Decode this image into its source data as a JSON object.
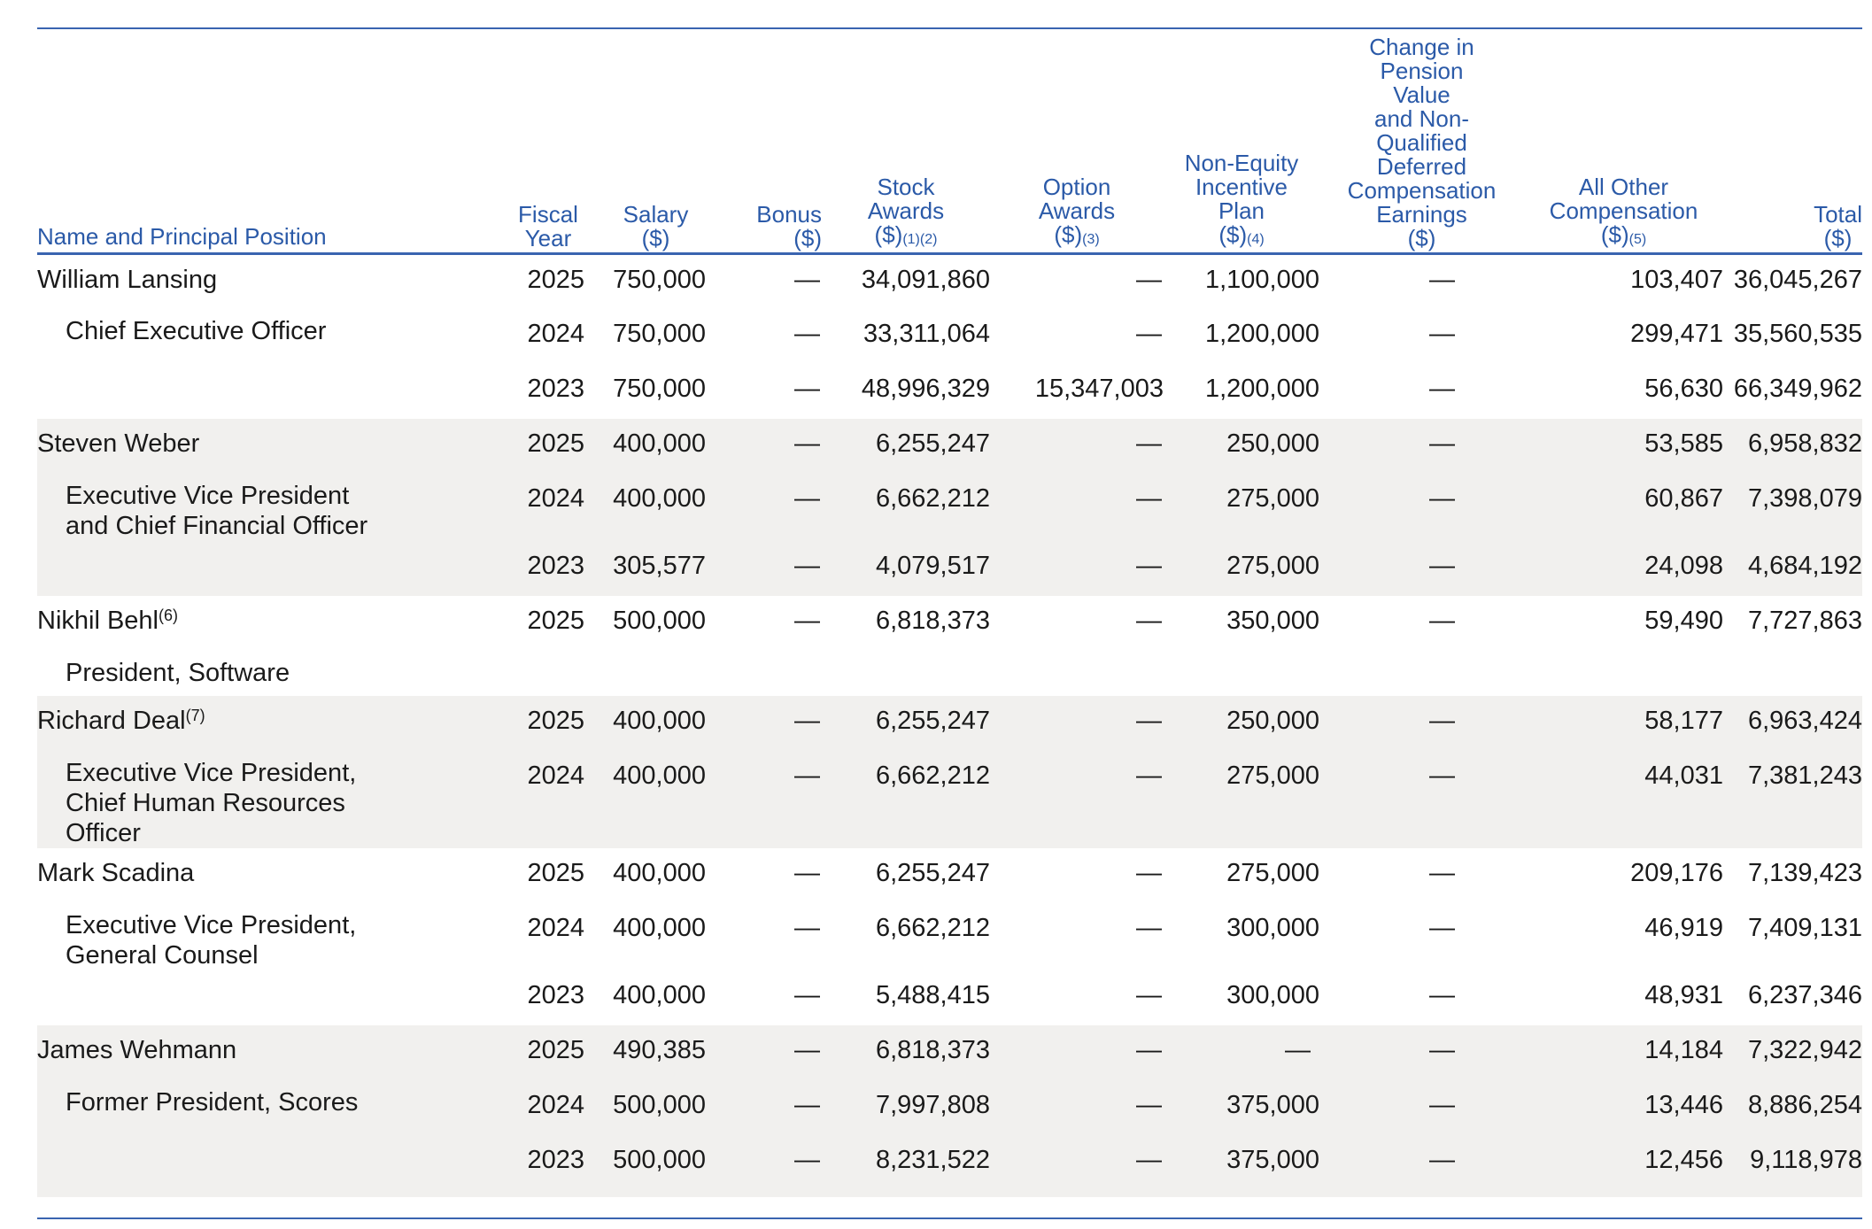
{
  "headers": {
    "name": "Name and Principal Position",
    "fiscal_year": "Fiscal\nYear",
    "salary": "Salary\n($)",
    "bonus": "Bonus\n($)",
    "stock_awards": "Stock\nAwards\n($)",
    "stock_awards_fn": "(1)(2)",
    "option_awards": "Option\nAwards\n($)",
    "option_awards_fn": "(3)",
    "non_equity": "Non-Equity\nIncentive\nPlan\n($)",
    "non_equity_fn": "(4)",
    "pension": "Change in\nPension\nValue\nand Non-\nQualified\nDeferred\nCompensation\nEarnings\n($)",
    "all_other": "All Other\nCompensation\n($)",
    "all_other_fn": "(5)",
    "total": "Total\n($)"
  },
  "rows": [
    {
      "name": "William Lansing",
      "fn": "",
      "sub": "",
      "year": "2025",
      "salary": "750,000",
      "bonus": "—",
      "stock": "34,091,860",
      "option": "—",
      "neip": "1,100,000",
      "pension": "—",
      "other": "103,407",
      "total": "36,045,267"
    },
    {
      "name": "",
      "fn": "",
      "sub": "Chief Executive Officer",
      "year": "2024",
      "salary": "750,000",
      "bonus": "—",
      "stock": "33,311,064",
      "option": "—",
      "neip": "1,200,000",
      "pension": "—",
      "other": "299,471",
      "total": "35,560,535"
    },
    {
      "name": "",
      "fn": "",
      "sub": "",
      "year": "2023",
      "salary": "750,000",
      "bonus": "—",
      "stock": "48,996,329",
      "option": "15,347,003",
      "neip": "1,200,000",
      "pension": "—",
      "other": "56,630",
      "total": "66,349,962"
    },
    {
      "name": "Steven Weber",
      "fn": "",
      "sub": "",
      "year": "2025",
      "salary": "400,000",
      "bonus": "—",
      "stock": "6,255,247",
      "option": "—",
      "neip": "250,000",
      "pension": "—",
      "other": "53,585",
      "total": "6,958,832"
    },
    {
      "name": "",
      "fn": "",
      "sub": "Executive Vice President and Chief Financial Officer",
      "year": "2024",
      "salary": "400,000",
      "bonus": "—",
      "stock": "6,662,212",
      "option": "—",
      "neip": "275,000",
      "pension": "—",
      "other": "60,867",
      "total": "7,398,079"
    },
    {
      "name": "",
      "fn": "",
      "sub": "",
      "year": "2023",
      "salary": "305,577",
      "bonus": "—",
      "stock": "4,079,517",
      "option": "—",
      "neip": "275,000",
      "pension": "—",
      "other": "24,098",
      "total": "4,684,192"
    },
    {
      "name": "Nikhil Behl",
      "fn": "(6)",
      "sub": "",
      "year": "2025",
      "salary": "500,000",
      "bonus": "—",
      "stock": "6,818,373",
      "option": "—",
      "neip": "350,000",
      "pension": "—",
      "other": "59,490",
      "total": "7,727,863"
    },
    {
      "name": "",
      "fn": "",
      "sub": "President, Software",
      "year": "",
      "salary": "",
      "bonus": "",
      "stock": "",
      "option": "",
      "neip": "",
      "pension": "",
      "other": "",
      "total": ""
    },
    {
      "name": "Richard Deal",
      "fn": "(7)",
      "sub": "",
      "year": "2025",
      "salary": "400,000",
      "bonus": "—",
      "stock": "6,255,247",
      "option": "—",
      "neip": "250,000",
      "pension": "—",
      "other": "58,177",
      "total": "6,963,424"
    },
    {
      "name": "",
      "fn": "",
      "sub": "Executive Vice President, Chief Human Resources Officer",
      "year": "2024",
      "salary": "400,000",
      "bonus": "—",
      "stock": "6,662,212",
      "option": "—",
      "neip": "275,000",
      "pension": "—",
      "other": "44,031",
      "total": "7,381,243"
    },
    {
      "name": "Mark Scadina",
      "fn": "",
      "sub": "",
      "year": "2025",
      "salary": "400,000",
      "bonus": "—",
      "stock": "6,255,247",
      "option": "—",
      "neip": "275,000",
      "pension": "—",
      "other": "209,176",
      "total": "7,139,423"
    },
    {
      "name": "",
      "fn": "",
      "sub": "Executive Vice President, General Counsel",
      "year": "2024",
      "salary": "400,000",
      "bonus": "—",
      "stock": "6,662,212",
      "option": "—",
      "neip": "300,000",
      "pension": "—",
      "other": "46,919",
      "total": "7,409,131"
    },
    {
      "name": "",
      "fn": "",
      "sub": "",
      "year": "2023",
      "salary": "400,000",
      "bonus": "—",
      "stock": "5,488,415",
      "option": "—",
      "neip": "300,000",
      "pension": "—",
      "other": "48,931",
      "total": "6,237,346"
    },
    {
      "name": "James Wehmann",
      "fn": "",
      "sub": "",
      "year": "2025",
      "salary": "490,385",
      "bonus": "—",
      "stock": "6,818,373",
      "option": "—",
      "neip": "—",
      "pension": "—",
      "other": "14,184",
      "total": "7,322,942"
    },
    {
      "name": "",
      "fn": "",
      "sub": "Former President, Scores",
      "year": "2024",
      "salary": "500,000",
      "bonus": "—",
      "stock": "7,997,808",
      "option": "—",
      "neip": "375,000",
      "pension": "—",
      "other": "13,446",
      "total": "8,886,254"
    },
    {
      "name": "",
      "fn": "",
      "sub": "",
      "year": "2023",
      "salary": "500,000",
      "bonus": "—",
      "stock": "8,231,522",
      "option": "—",
      "neip": "375,000",
      "pension": "—",
      "other": "12,456",
      "total": "9,118,978"
    }
  ],
  "row_heights": [
    62,
    62,
    62,
    62,
    74,
    62,
    62,
    51,
    62,
    100,
    62,
    70,
    62,
    62,
    62,
    70
  ],
  "gray_groups": [
    false,
    false,
    false,
    true,
    true,
    true,
    false,
    false,
    true,
    true,
    false,
    false,
    false,
    true,
    true,
    true
  ]
}
